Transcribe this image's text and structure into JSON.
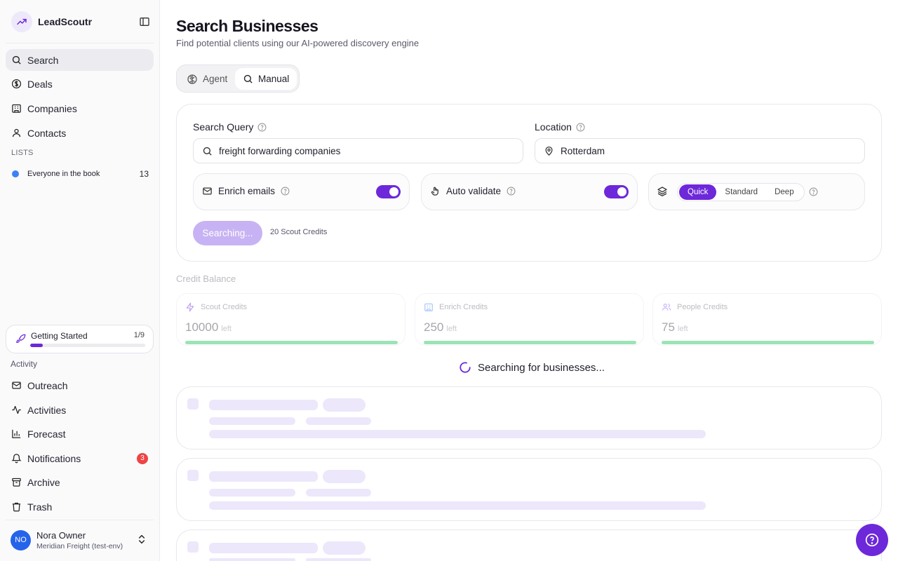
{
  "brand": {
    "name": "LeadScoutr"
  },
  "nav": {
    "main": [
      {
        "label": "Search",
        "icon": "search-icon"
      },
      {
        "label": "Deals",
        "icon": "dollar-icon"
      },
      {
        "label": "Companies",
        "icon": "building-icon"
      },
      {
        "label": "Contacts",
        "icon": "user-icon"
      }
    ],
    "lists_label": "LISTS",
    "lists": [
      {
        "label": "Everyone in the book",
        "count": "13",
        "color": "#3b82f6"
      }
    ],
    "getting_started": {
      "label": "Getting Started",
      "progress": "1/9",
      "fraction": 0.11
    },
    "activity_label": "Activity",
    "activity": [
      {
        "label": "Outreach",
        "icon": "mail-icon"
      },
      {
        "label": "Activities",
        "icon": "activity-icon"
      },
      {
        "label": "Forecast",
        "icon": "bar-chart-icon"
      },
      {
        "label": "Notifications",
        "icon": "bell-icon",
        "badge": "3"
      },
      {
        "label": "Archive",
        "icon": "archive-icon"
      },
      {
        "label": "Trash",
        "icon": "trash-icon"
      }
    ]
  },
  "user": {
    "initials": "NO",
    "name": "Nora Owner",
    "org": "Meridian Freight (test-env)"
  },
  "page": {
    "title": "Search Businesses",
    "subtitle": "Find potential clients using our AI-powered discovery engine"
  },
  "modes": {
    "agent": "Agent",
    "manual": "Manual",
    "active": "Manual"
  },
  "search": {
    "query_label": "Search Query",
    "query_value": "freight forwarding companies",
    "location_label": "Location",
    "location_value": "Rotterdam",
    "enrich_emails": "Enrich emails",
    "auto_validate": "Auto validate",
    "depth": {
      "options": [
        "Quick",
        "Standard",
        "Deep"
      ],
      "selected": "Quick"
    },
    "button": "Searching...",
    "cost": "20 Scout Credits"
  },
  "credits": {
    "title": "Credit Balance",
    "left_label": "left",
    "items": [
      {
        "label": "Scout Credits",
        "value": "10000",
        "icon": "bolt-icon"
      },
      {
        "label": "Enrich Credits",
        "value": "250",
        "icon": "building-icon"
      },
      {
        "label": "People Credits",
        "value": "75",
        "icon": "users-icon"
      }
    ]
  },
  "status": {
    "searching": "Searching for businesses..."
  },
  "colors": {
    "accent": "#6d28d9",
    "accent_soft": "#c7b3f3",
    "success": "#22c55e",
    "danger": "#ef4444"
  }
}
